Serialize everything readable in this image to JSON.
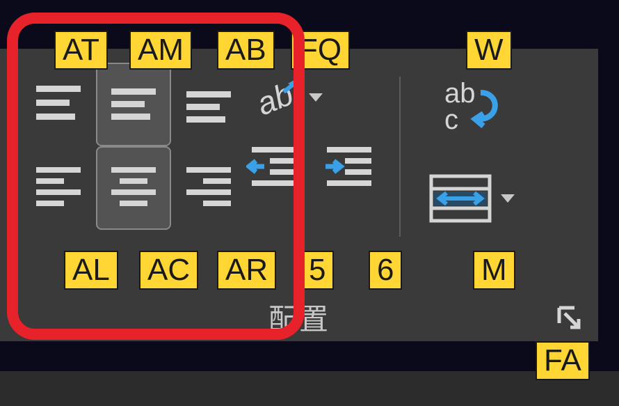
{
  "group_label": "配置",
  "keytips": {
    "align_top": "AT",
    "align_middle": "AM",
    "align_bottom": "AB",
    "orientation": "FQ",
    "wrap_text": "W",
    "align_left": "AL",
    "align_center": "AC",
    "align_right": "AR",
    "indent_dec": "5",
    "indent_inc": "6",
    "merge": "M",
    "launcher": "FA"
  },
  "selected": {
    "vertical": "middle",
    "horizontal": "center"
  },
  "colors": {
    "bg": "#3a3a3a",
    "icon": "#d5d5d5",
    "accent": "#3aa0e8",
    "keytip_bg": "#ffd633",
    "highlight": "#e8222a"
  }
}
